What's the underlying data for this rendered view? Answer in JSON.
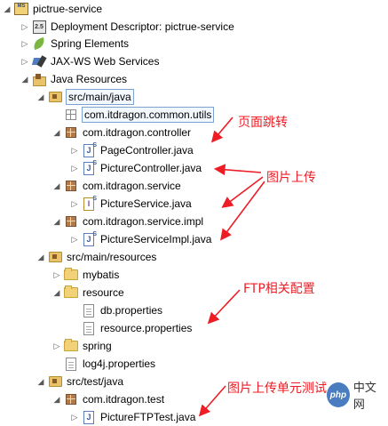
{
  "tree": {
    "project": "pictrue-service",
    "deployment_descriptor": "Deployment Descriptor: pictrue-service",
    "spring_elements": "Spring Elements",
    "jaxws": "JAX-WS Web Services",
    "java_resources": "Java Resources",
    "src_main_java": "src/main/java",
    "pkg_common_utils": "com.itdragon.common.utils",
    "pkg_controller": "com.itdragon.controller",
    "page_controller": "PageController.java",
    "picture_controller": "PictureController.java",
    "pkg_service": "com.itdragon.service",
    "picture_service": "PictureService.java",
    "pkg_service_impl": "com.itdragon.service.impl",
    "picture_service_impl": "PictureServiceImpl.java",
    "src_main_resources": "src/main/resources",
    "mybatis": "mybatis",
    "resource": "resource",
    "db_properties": "db.properties",
    "resource_properties": "resource.properties",
    "spring": "spring",
    "log4j": "log4j.properties",
    "src_test_java": "src/test/java",
    "pkg_test": "com.itdragon.test",
    "picture_ftp_test": "PictureFTPTest.java"
  },
  "annotations": {
    "page_jump": "页面跳转",
    "image_upload": "图片上传",
    "ftp_config": "FTP相关配置",
    "upload_unit_test": "图片上传单元测试"
  },
  "watermark": {
    "logo": "php",
    "text": "中文网"
  },
  "colors": {
    "annotation": "#ee1c24",
    "selection_border": "#7da2ce"
  }
}
